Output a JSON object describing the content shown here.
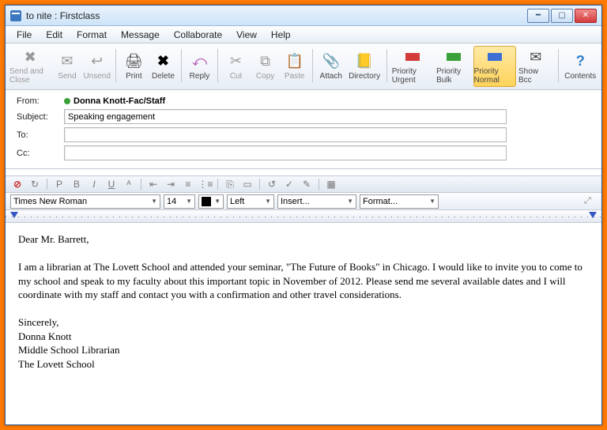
{
  "window": {
    "title": "to nite : Firstclass"
  },
  "menu": {
    "items": [
      "File",
      "Edit",
      "Format",
      "Message",
      "Collaborate",
      "View",
      "Help"
    ]
  },
  "toolbar": {
    "send_close": "Send and Close",
    "send": "Send",
    "unsend": "Unsend",
    "print": "Print",
    "delete": "Delete",
    "reply": "Reply",
    "cut": "Cut",
    "copy": "Copy",
    "paste": "Paste",
    "attach": "Attach",
    "directory": "Directory",
    "priority_urgent": "Priority Urgent",
    "priority_bulk": "Priority Bulk",
    "priority_normal": "Priority Normal",
    "show_bcc": "Show Bcc",
    "contents": "Contents"
  },
  "header": {
    "from_label": "From:",
    "from_value": "Donna Knott-Fac/Staff",
    "subject_label": "Subject:",
    "subject_value": "Speaking engagement",
    "to_label": "To:",
    "to_value": "",
    "cc_label": "Cc:",
    "cc_value": ""
  },
  "format": {
    "font": "Times New Roman",
    "size": "14",
    "align": "Left",
    "insert": "Insert...",
    "formatmenu": "Format..."
  },
  "body": {
    "greeting": "Dear Mr. Barrett,",
    "para1": "I am a librarian at The Lovett School and attended your seminar, \"The Future of Books\" in Chicago.  I would like to invite you to come to my school and speak to my faculty about this important topic in November of 2012.  Please send me several available dates and I will coordinate with my staff and contact you with a confirmation and other travel considerations.",
    "sign1": "Sincerely,",
    "sign2": "Donna Knott",
    "sign3": "Middle School Librarian",
    "sign4": "The Lovett School"
  }
}
